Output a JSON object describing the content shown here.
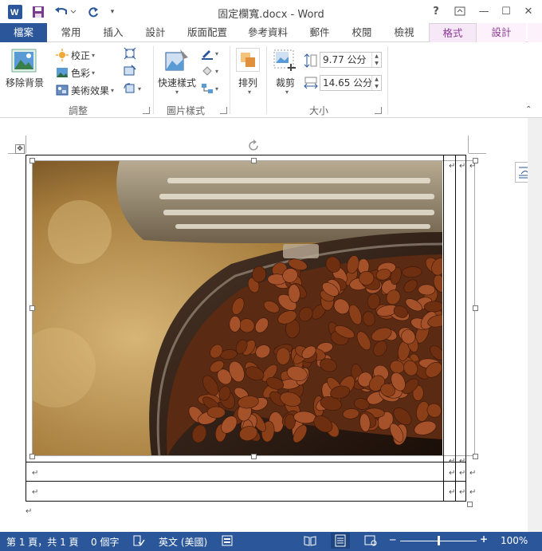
{
  "window": {
    "title": "固定欄寬.docx - Word",
    "help": "?",
    "restore_ribbon": "⧉",
    "minimize": "—",
    "maximize": "☐",
    "close": "✕"
  },
  "tabs": [
    "檔案",
    "常用",
    "插入",
    "設計",
    "版面配置",
    "參考資料",
    "郵件",
    "校閱",
    "檢視",
    "格式",
    "設計"
  ],
  "ribbon": {
    "remove_background": "移除背景",
    "corrections": "校正",
    "color": "色彩",
    "artistic_effects": "美術效果",
    "quick_styles": "快速樣式",
    "arrange": "排列",
    "crop": "裁剪",
    "height_value": "9.77 公分",
    "width_value": "14.65 公分",
    "group_adjust": "調整",
    "group_picture_styles": "圖片樣式",
    "group_size": "大小"
  },
  "document": {
    "paragraph_mark": "↵",
    "image_description": "coffee-beans-in-tin"
  },
  "status": {
    "page": "第 1 頁，共 1 頁",
    "words": "0 個字",
    "language": "英文 (美國)",
    "zoom": "100%",
    "zoom_level": 1.0
  },
  "colors": {
    "brand": "#2b579a",
    "context_tab": "#8c3a95"
  }
}
